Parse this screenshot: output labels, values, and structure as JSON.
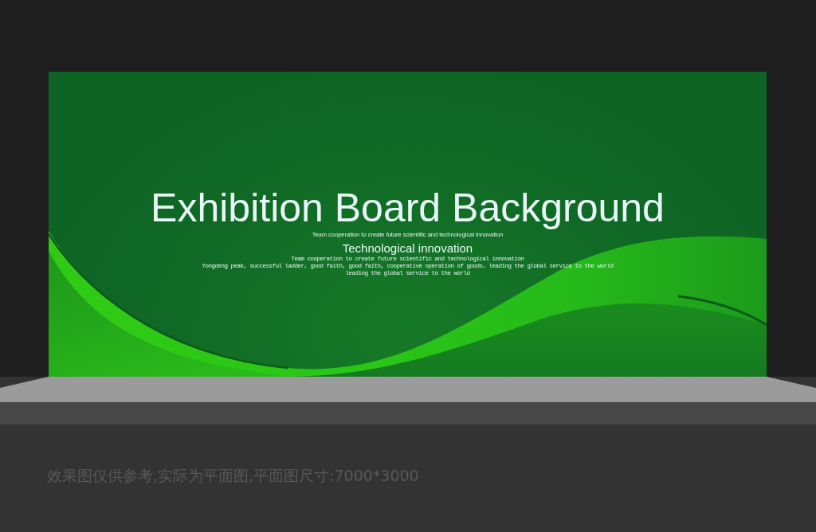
{
  "board": {
    "title": "Exhibition Board Background",
    "tagline": "Team cooperation to create future scientific and technological innovation",
    "subtitle": "Technological innovation",
    "body_lines": [
      "Team cooperation to create future scientific and technological innovation",
      "Yongdeng peak, successful ladder, good faith, good faith, cooperative operation of goods, leading the global service to the world",
      "leading the global service to the world"
    ]
  },
  "note": "效果图仅供参考,实际为平面图,平面图尺寸:7000*3000"
}
